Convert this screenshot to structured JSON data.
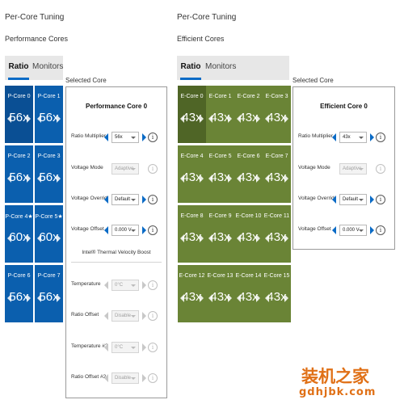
{
  "left": {
    "title": "Per-Core Tuning",
    "subtitle": "Performance Cores",
    "tabs": [
      {
        "label": "Ratio"
      },
      {
        "label": "Monitors"
      }
    ],
    "selected_caption": "Selected Core",
    "cores": [
      {
        "name": "P-Core 0",
        "value": "56x"
      },
      {
        "name": "P-Core 1",
        "value": "56x"
      },
      {
        "name": "P-Core 2",
        "value": "56x"
      },
      {
        "name": "P-Core 3",
        "value": "56x"
      },
      {
        "name": "P-Core 4★",
        "value": "60x"
      },
      {
        "name": "P-Core 5★",
        "value": "60x"
      },
      {
        "name": "P-Core 6",
        "value": "56x"
      },
      {
        "name": "P-Core 7",
        "value": "56x"
      }
    ],
    "panel": {
      "title": "Performance Core 0",
      "rows": [
        {
          "label": "Ratio Multiplier",
          "value": "56x"
        },
        {
          "label": "Voltage Mode",
          "value": "Adaptive"
        },
        {
          "label": "Voltage Overrid",
          "value": "Default"
        },
        {
          "label": "Voltage Offset",
          "value": "0.000 V"
        }
      ],
      "tvb_title": "Intel® Thermal Velocity Boost",
      "tvb_rows": [
        {
          "label": "Temperature",
          "value": "0°C"
        },
        {
          "label": "Ratio Offset",
          "value": "Disable"
        },
        {
          "label": "Temperature #2",
          "value": "0°C"
        },
        {
          "label": "Ratio Offset #2",
          "value": "Disable"
        }
      ]
    }
  },
  "right": {
    "title": "Per-Core Tuning",
    "subtitle": "Efficient Cores",
    "tabs": [
      {
        "label": "Ratio"
      },
      {
        "label": "Monitors"
      }
    ],
    "selected_caption": "Selected Core",
    "cores": [
      {
        "name": "E-Core 0",
        "value": "43x"
      },
      {
        "name": "E-Core 1",
        "value": "43x"
      },
      {
        "name": "E-Core 2",
        "value": "43x"
      },
      {
        "name": "E-Core 3",
        "value": "43x"
      },
      {
        "name": "E-Core 4",
        "value": "43x"
      },
      {
        "name": "E-Core 5",
        "value": "43x"
      },
      {
        "name": "E-Core 6",
        "value": "43x"
      },
      {
        "name": "E-Core 7",
        "value": "43x"
      },
      {
        "name": "E-Core 8",
        "value": "43x"
      },
      {
        "name": "E-Core 9",
        "value": "43x"
      },
      {
        "name": "E-Core 10",
        "value": "43x"
      },
      {
        "name": "E-Core 11",
        "value": "43x"
      },
      {
        "name": "E-Core 12",
        "value": "43x"
      },
      {
        "name": "E-Core 13",
        "value": "43x"
      },
      {
        "name": "E-Core 14",
        "value": "43x"
      },
      {
        "name": "E-Core 15",
        "value": "43x"
      }
    ],
    "panel": {
      "title": "Efficient Core 0",
      "rows": [
        {
          "label": "Ratio Multiplier",
          "value": "43x"
        },
        {
          "label": "Voltage Mode",
          "value": "Adaptive"
        },
        {
          "label": "Voltage Overrid",
          "value": "Default"
        },
        {
          "label": "Voltage Offset",
          "value": "0.000 V"
        }
      ]
    }
  },
  "info_glyph": "i",
  "watermark": {
    "cn": "装机之家",
    "url": "gdhjbk.com"
  },
  "colors": {
    "p_core": "#0b5fae",
    "e_core": "#6a8436",
    "accent": "#0a6bc6"
  }
}
